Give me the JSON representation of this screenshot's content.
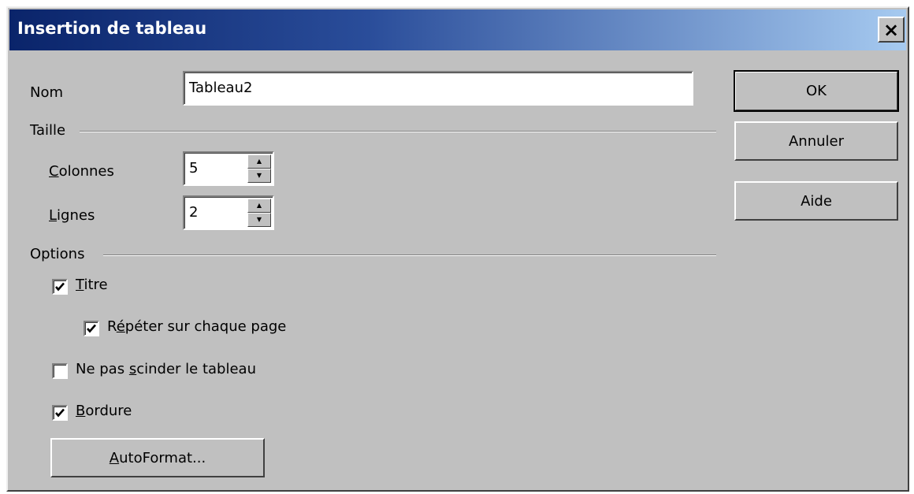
{
  "window": {
    "title": "Insertion de tableau",
    "close_glyph": "×"
  },
  "nom": {
    "label": "Nom",
    "value": "Tableau2"
  },
  "taille": {
    "section_label": "Taille",
    "colonnes": {
      "label_first": "C",
      "label_rest": "olonnes",
      "value": "5"
    },
    "lignes": {
      "label_first": "L",
      "label_rest": "ignes",
      "value": "2"
    }
  },
  "options": {
    "section_label": "Options",
    "titre": {
      "label_first": "T",
      "label_rest": "itre",
      "checked": true
    },
    "repeter": {
      "label_first": "R",
      "label_mid": "é",
      "label_rest": "péter sur chaque page",
      "checked": true
    },
    "ne_pas_scinder": {
      "label_before": "Ne pas ",
      "label_u": "s",
      "label_rest": "cinder le tableau",
      "checked": false
    },
    "bordure": {
      "label_first": "B",
      "label_rest": "ordure",
      "checked": true
    },
    "autoformat": {
      "label_first": "A",
      "label_rest": "utoFormat..."
    }
  },
  "buttons": {
    "ok": "OK",
    "annuler": "Annuler",
    "aide": "Aide"
  },
  "icons": {
    "close": "close-icon",
    "spin_up": "spin-up-icon",
    "spin_down": "spin-down-icon",
    "checkmark": "checkmark-icon"
  },
  "colors": {
    "titlebar_start": "#0a246a",
    "titlebar_end": "#a6caf0",
    "dialog_bg": "#c0c0c0"
  }
}
